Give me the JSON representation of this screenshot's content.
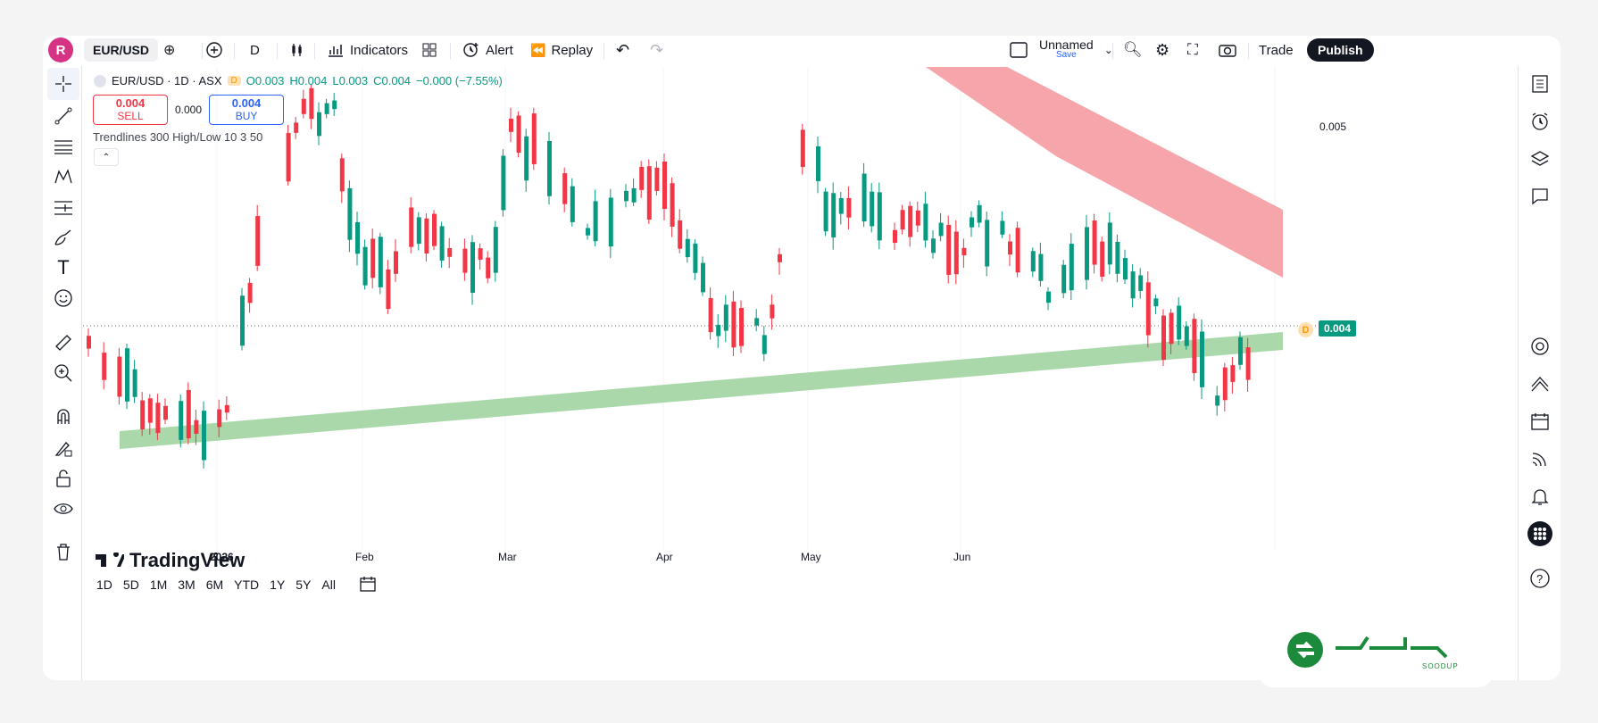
{
  "header": {
    "avatar_letter": "R",
    "symbol": "EUR/USD",
    "interval": "D",
    "indicators": "Indicators",
    "alert": "Alert",
    "replay": "Replay",
    "layout_name": "Unnamed",
    "layout_save": "Save",
    "trade": "Trade",
    "publish": "Publish"
  },
  "legend": {
    "title": "EUR/USD · 1D · ASX",
    "badge": "D",
    "o": "O0.003",
    "h": "H0.004",
    "l": "L0.003",
    "c": "C0.004",
    "change": "−0.000 (−7.55%)"
  },
  "trade": {
    "sell_price": "0.004",
    "sell_label": "SELL",
    "spread": "0.000",
    "buy_price": "0.004",
    "buy_label": "BUY"
  },
  "indicator_label": "Trendlines 300 High/Low 10 3 50",
  "price_axis": {
    "top_value": "0.005",
    "current_value": "0.004"
  },
  "watermark": "TradingView",
  "time_axis": [
    "2026",
    "Feb",
    "Mar",
    "Apr",
    "May",
    "Jun"
  ],
  "ranges": [
    "1D",
    "5D",
    "1M",
    "3M",
    "6M",
    "YTD",
    "1Y",
    "5Y",
    "All"
  ],
  "brand": {
    "name": "SOODUP"
  },
  "colors": {
    "up": "#089981",
    "down": "#f23645",
    "support": "#a5d6a7",
    "resistance": "#f5a0a5"
  },
  "icons": {
    "left": [
      "crosshair-icon",
      "trendline-icon",
      "fib-icon",
      "pattern-icon",
      "forecast-icon",
      "brush-icon",
      "text-icon",
      "emoji-icon",
      "ruler-icon",
      "zoom-icon",
      "magnet-icon",
      "lock-draw-icon",
      "lock-icon",
      "eye-icon",
      "trash-icon"
    ],
    "right": [
      "watchlist-icon",
      "alerts-icon",
      "layers-icon",
      "chat-icon",
      "target-icon",
      "ideas-icon",
      "calendar-icon",
      "stream-icon",
      "bell-icon",
      "apps-icon",
      "help-icon"
    ]
  }
}
